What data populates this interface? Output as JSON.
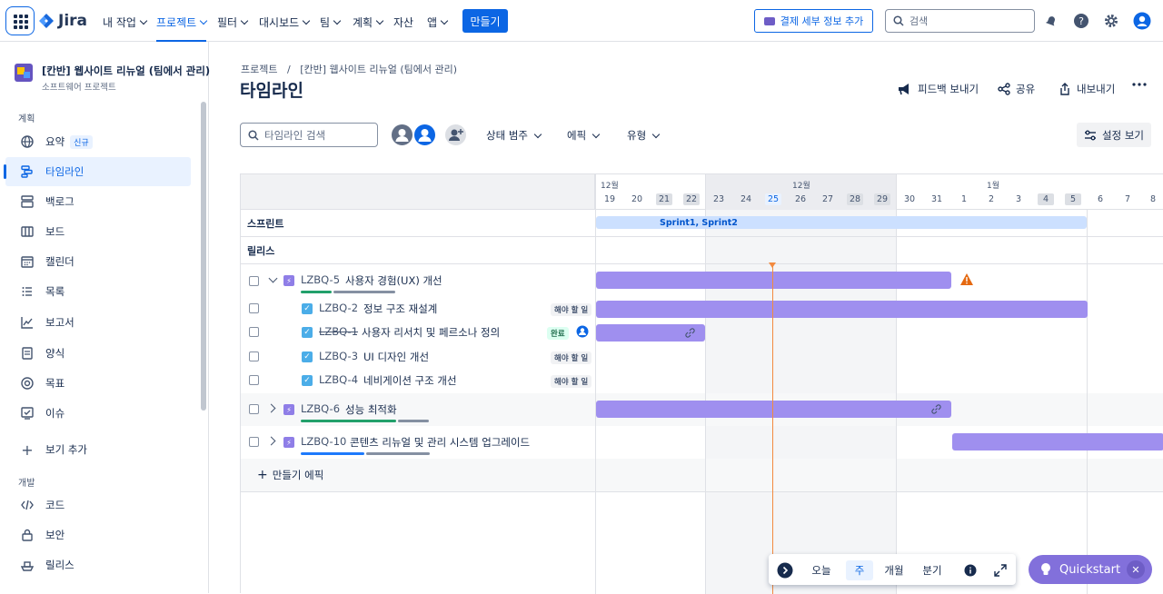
{
  "topnav": {
    "logo": "Jira",
    "items": [
      "내 작업",
      "프로젝트",
      "필터",
      "대시보드",
      "팀",
      "계획",
      "자산",
      "앱"
    ],
    "create": "만들기",
    "billing": "결제 세부 정보 추가",
    "search_placeholder": "검색"
  },
  "sidebar": {
    "project_title": "[칸반] 웹사이트 리뉴얼 (팀에서 관리)",
    "project_sub": "소프트웨어 프로젝트",
    "section_plan": "계획",
    "new_badge": "신규",
    "plan_items": [
      "요약",
      "타임라인",
      "백로그",
      "보드",
      "캘린더",
      "목록",
      "보고서",
      "양식",
      "목표",
      "이슈"
    ],
    "add_view": "보기 추가",
    "section_dev": "개발",
    "dev_items": [
      "코드",
      "보안",
      "릴리스"
    ]
  },
  "page": {
    "breadcrumb_root": "프로젝트",
    "breadcrumb_sep": "/",
    "breadcrumb_project": "[칸반] 웹사이트 리뉴얼 (팀에서 관리)",
    "title": "타임라인",
    "feedback": "피드백 보내기",
    "share": "공유",
    "export": "내보내기",
    "timeline_search": "타임라인 검색",
    "filters": [
      "상태 범주",
      "에픽",
      "유형"
    ],
    "view_settings": "설정 보기"
  },
  "timeline": {
    "months": [
      "12월",
      "12월",
      "1월"
    ],
    "days": [
      "19",
      "20",
      "21",
      "22",
      "23",
      "24",
      "25",
      "26",
      "27",
      "28",
      "29",
      "30",
      "31",
      "1",
      "2",
      "3",
      "4",
      "5",
      "6",
      "7",
      "8"
    ],
    "sprints_label": "스프린트",
    "releases_label": "릴리스",
    "sprint_bar": "Sprint1, Sprint2",
    "rows": [
      {
        "key": "LZBQ-5",
        "summary": "사용자 경험(UX) 개선",
        "type": "epic"
      },
      {
        "key": "LZBQ-2",
        "summary": "정보 구조 재설계",
        "type": "task",
        "status": "해야 할 일"
      },
      {
        "key": "LZBQ-1",
        "summary": "사용자 리서치 및 페르소나 정의",
        "type": "task",
        "status": "완료"
      },
      {
        "key": "LZBQ-3",
        "summary": "UI 디자인 개선",
        "type": "task",
        "status": "해야 할 일"
      },
      {
        "key": "LZBQ-4",
        "summary": "네비게이션 구조 개선",
        "type": "task",
        "status": "해야 할 일"
      },
      {
        "key": "LZBQ-6",
        "summary": "성능 최적화",
        "type": "epic"
      },
      {
        "key": "LZBQ-10",
        "summary": "콘텐츠 리뉴얼 및 관리 시스템 업그레이드",
        "type": "epic"
      }
    ],
    "create_epic": "만들기 에픽"
  },
  "zoom": {
    "today": "오늘",
    "week": "주",
    "month": "개월",
    "quarter": "분기"
  },
  "quickstart": "Quickstart",
  "colors": {
    "accent": "#0c66e4",
    "bar": "#9f8fef",
    "today_line": "#f38a3f"
  }
}
